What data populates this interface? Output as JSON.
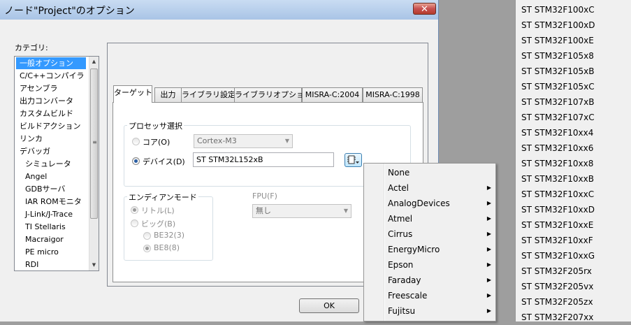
{
  "dialog": {
    "title": "ノード\"Project\"のオプション",
    "close_label": "✕",
    "category_label": "カテゴリ:",
    "categories": [
      {
        "label": "一般オプション",
        "selected": true,
        "sub": false
      },
      {
        "label": "C/C++コンパイラ",
        "sub": false
      },
      {
        "label": "アセンブラ",
        "sub": false
      },
      {
        "label": "出力コンバータ",
        "sub": false
      },
      {
        "label": "カスタムビルド",
        "sub": false
      },
      {
        "label": "ビルドアクション",
        "sub": false
      },
      {
        "label": "リンカ",
        "sub": false
      },
      {
        "label": "デバッガ",
        "sub": false
      },
      {
        "label": "シミュレータ",
        "sub": true
      },
      {
        "label": "Angel",
        "sub": true
      },
      {
        "label": "GDBサーバ",
        "sub": true
      },
      {
        "label": "IAR ROMモニタ",
        "sub": true
      },
      {
        "label": "J-Link/J-Trace",
        "sub": true
      },
      {
        "label": "TI Stellaris",
        "sub": true
      },
      {
        "label": "Macraigor",
        "sub": true
      },
      {
        "label": "PE micro",
        "sub": true
      },
      {
        "label": "RDI",
        "sub": true
      }
    ],
    "tabs": [
      "ターゲット",
      "出力",
      "ライブラリ設定",
      "ライブラリオプション",
      "MISRA-C:2004",
      "MISRA-C:1998"
    ],
    "processor_group": "プロセッサ選択",
    "core_label": "コア(O)",
    "core_value": "Cortex-M3",
    "device_label": "デバイス(D)",
    "device_value": "ST STM32L152xB",
    "endian_group": "エンディアンモード",
    "little_label": "リトル(L)",
    "big_label": "ビッグ(B)",
    "be32_label": "BE32(3)",
    "be8_label": "BE8(8)",
    "fpu_label": "FPU(F)",
    "fpu_value": "無し",
    "ok_label": "OK"
  },
  "popup_menu": {
    "items": [
      {
        "label": "None",
        "submenu": false
      },
      {
        "label": "Actel",
        "submenu": true
      },
      {
        "label": "AnalogDevices",
        "submenu": true
      },
      {
        "label": "Atmel",
        "submenu": true
      },
      {
        "label": "Cirrus",
        "submenu": true
      },
      {
        "label": "EnergyMicro",
        "submenu": true
      },
      {
        "label": "Epson",
        "submenu": true
      },
      {
        "label": "Faraday",
        "submenu": true
      },
      {
        "label": "Freescale",
        "submenu": true
      },
      {
        "label": "Fujitsu",
        "submenu": true
      }
    ]
  },
  "device_list": {
    "items": [
      "ST STM32F100xC",
      "ST STM32F100xD",
      "ST STM32F100xE",
      "ST STM32F105x8",
      "ST STM32F105xB",
      "ST STM32F105xC",
      "ST STM32F107xB",
      "ST STM32F107xC",
      "ST STM32F10xx4",
      "ST STM32F10xx6",
      "ST STM32F10xx8",
      "ST STM32F10xxB",
      "ST STM32F10xxC",
      "ST STM32F10xxD",
      "ST STM32F10xxE",
      "ST STM32F10xxF",
      "ST STM32F10xxG",
      "ST STM32F205rx",
      "ST STM32F205vx",
      "ST STM32F205zx",
      "ST STM32F207xx"
    ]
  }
}
